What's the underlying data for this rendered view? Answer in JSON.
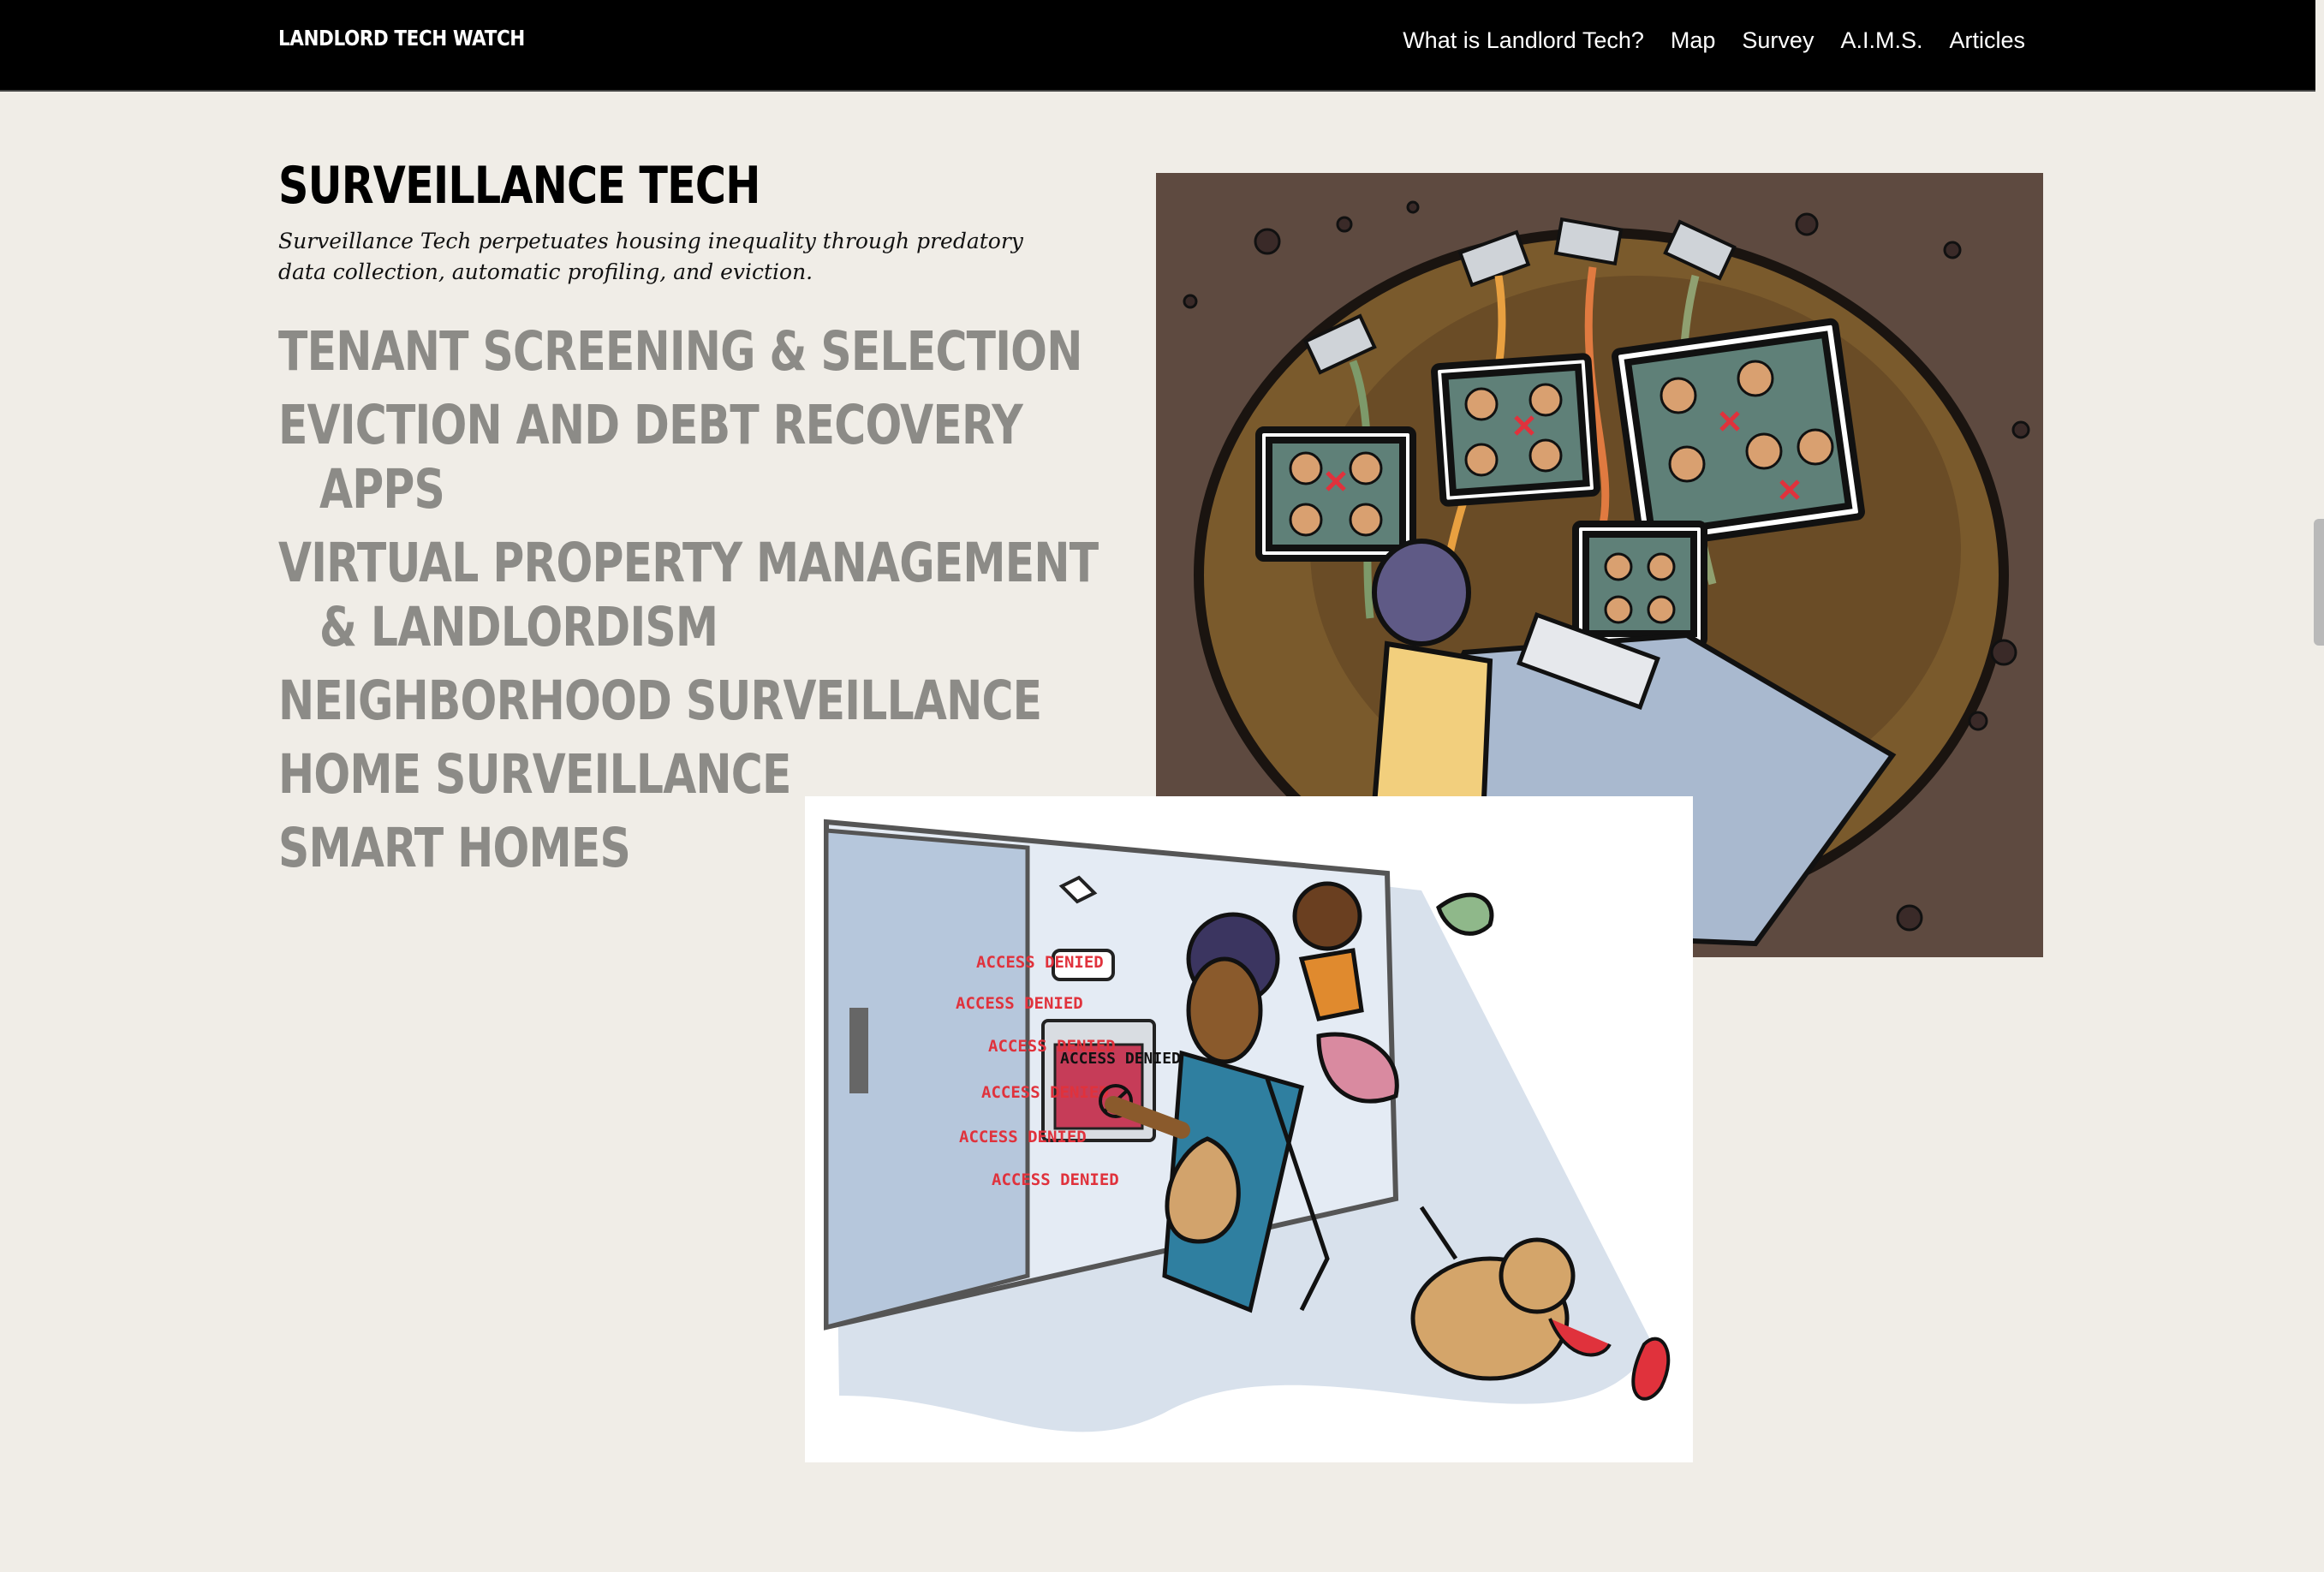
{
  "header": {
    "brand": "LANDLORD TECH WATCH",
    "nav": [
      "What is Landlord Tech?",
      "Map",
      "Survey",
      "A.I.M.S.",
      "Articles"
    ]
  },
  "main": {
    "title": "SURVEILLANCE TECH",
    "subtitle": "Surveillance Tech perpetuates housing inequality through predatory data collection, automatic profiling, and eviction.",
    "categories": [
      "TENANT SCREENING & SELECTION",
      "EVICTION AND DEBT RECOVERY APPS",
      "VIRTUAL PROPERTY MANAGEMENT & LANDLORDISM",
      "NEIGHBORHOOD SURVEILLANCE",
      "HOME SURVEILLANCE",
      "SMART HOMES"
    ]
  },
  "illustration_text": {
    "access_denied": [
      "ACCESS DENIED",
      "ACCESS DENIED",
      "ACCESS DENIED",
      "ACCESS DENIED",
      "ACCESS DENIED",
      "ACCESS DENIED",
      "ACCESS DENIED"
    ]
  },
  "colors": {
    "topbar": "#000000",
    "background": "#f0ede7",
    "category_text": "#8c8b87",
    "illustration_bg": "#5e4a40",
    "access_red": "#e0323c"
  }
}
